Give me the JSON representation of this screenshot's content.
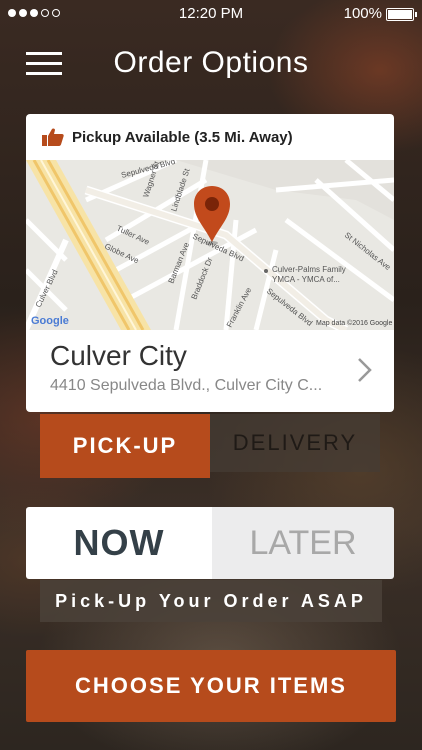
{
  "status": {
    "time": "12:20 PM",
    "battery": "100%"
  },
  "header": {
    "title": "Order Options"
  },
  "location_card": {
    "pickup_status": "Pickup Available (3.5 Mi. Away)",
    "map": {
      "labels": [
        "Sepulveda Blvd",
        "Wagner St",
        "Lindblade St",
        "Tuller Ave",
        "Globe Ave",
        "Sepulveda Blvd",
        "Barman Ave",
        "Braddock Dr",
        "Culver-Palms Family",
        "YMCA - YMCA of...",
        "Franklin Ave",
        "St Nicholas Ave",
        "Sepulveda Blvd",
        "Culver Blvd"
      ],
      "logo": "Google",
      "attribution": "Map data ©2016 Google"
    },
    "name": "Culver City",
    "address": "4410 Sepulveda Blvd., Culver City C..."
  },
  "fulfillment": {
    "pickup": "PICK-UP",
    "delivery": "DELIVERY"
  },
  "timing": {
    "now": "NOW",
    "later": "LATER",
    "message": "Pick-Up Your Order ASAP"
  },
  "cta": {
    "label": "CHOOSE YOUR ITEMS"
  },
  "colors": {
    "accent": "#b64b1c",
    "marker": "#c24a1c"
  }
}
